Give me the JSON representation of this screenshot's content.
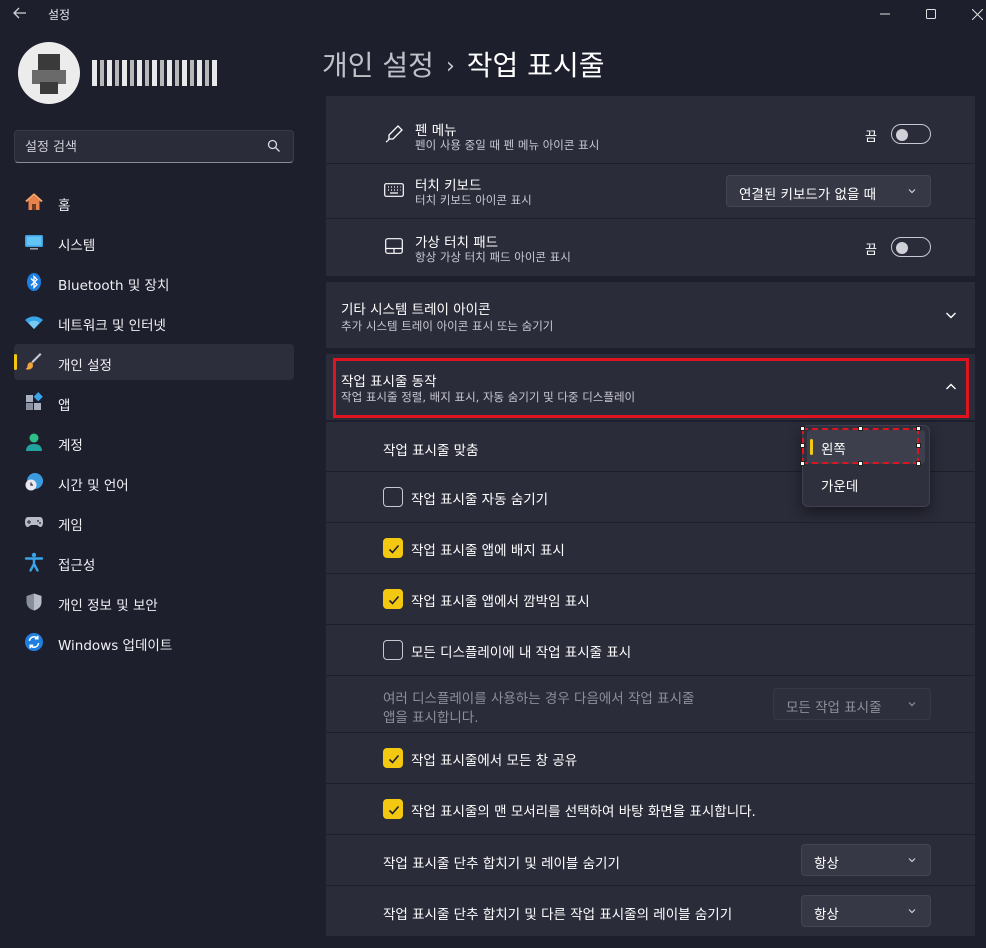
{
  "window": {
    "title": "설정"
  },
  "profile": {
    "username": "(blurred)"
  },
  "search": {
    "placeholder": "설정 검색"
  },
  "nav": {
    "items": [
      {
        "label": "홈",
        "icon": "home-icon"
      },
      {
        "label": "시스템",
        "icon": "monitor-icon"
      },
      {
        "label": "Bluetooth 및 장치",
        "icon": "bluetooth-icon"
      },
      {
        "label": "네트워크 및 인터넷",
        "icon": "wifi-icon"
      },
      {
        "label": "개인 설정",
        "icon": "paintbrush-icon",
        "active": true
      },
      {
        "label": "앱",
        "icon": "apps-icon"
      },
      {
        "label": "계정",
        "icon": "account-icon"
      },
      {
        "label": "시간 및 언어",
        "icon": "clock-globe-icon"
      },
      {
        "label": "게임",
        "icon": "gamepad-icon"
      },
      {
        "label": "접근성",
        "icon": "accessibility-icon"
      },
      {
        "label": "개인 정보 및 보안",
        "icon": "shield-icon"
      },
      {
        "label": "Windows 업데이트",
        "icon": "update-icon"
      }
    ]
  },
  "breadcrumb": {
    "parent": "개인 설정",
    "separator": "›",
    "current": "작업 표시줄"
  },
  "corner_icons": {
    "pen_menu": {
      "title": "펜 메뉴",
      "subtitle": "펜이 사용 중일 때 펜 메뉴 아이콘 표시",
      "toggle_label": "끔",
      "toggle_on": false
    },
    "touch_keyboard": {
      "title": "터치 키보드",
      "subtitle": "터치 키보드 아이콘 표시",
      "value": "연결된 키보드가 없을 때"
    },
    "virtual_touchpad": {
      "title": "가상 터치 패드",
      "subtitle": "항상 가상 터치 패드 아이콘 표시",
      "toggle_label": "끔",
      "toggle_on": false
    }
  },
  "other_tray": {
    "title": "기타 시스템 트레이 아이콘",
    "subtitle": "추가 시스템 트레이 아이콘 표시 또는 숨기기"
  },
  "behaviors": {
    "title": "작업 표시줄 동작",
    "subtitle": "작업 표시줄 정렬, 배지 표시, 자동 숨기기 및 다중 디스플레이",
    "alignment_label": "작업 표시줄 맞춤",
    "alignment_options": [
      "왼쪽",
      "가운데"
    ],
    "alignment_selected": "왼쪽",
    "auto_hide": {
      "label": "작업 표시줄 자동 숨기기",
      "checked": false
    },
    "badges": {
      "label": "작업 표시줄 앱에 배지 표시",
      "checked": true
    },
    "flashing": {
      "label": "작업 표시줄 앱에서 깜박임 표시",
      "checked": true
    },
    "all_displays": {
      "label": "모든 디스플레이에 내 작업 표시줄 표시",
      "checked": false
    },
    "multi_display_line1": "여러 디스플레이를 사용하는 경우 다음에서 작업 표시줄",
    "multi_display_line2": "앱을 표시합니다.",
    "multi_display_value": "모든 작업 표시줄",
    "share_windows": {
      "label": "작업 표시줄에서 모든 창 공유",
      "checked": true
    },
    "far_corner": {
      "label": "작업 표시줄의 맨 모서리를 선택하여 바탕 화면을 표시합니다.",
      "checked": true
    },
    "combine_main_label": "작업 표시줄 단추 합치기 및 레이블 숨기기",
    "combine_main_value": "항상",
    "combine_other_label": "작업 표시줄 단추 합치기 및 다른 작업 표시줄의 레이블 숨기기",
    "combine_other_value": "항상"
  },
  "colors": {
    "accent": "#f2c811",
    "background": "#1e1f2c",
    "card": "#2b2c3a",
    "highlight": "#e0141f"
  }
}
